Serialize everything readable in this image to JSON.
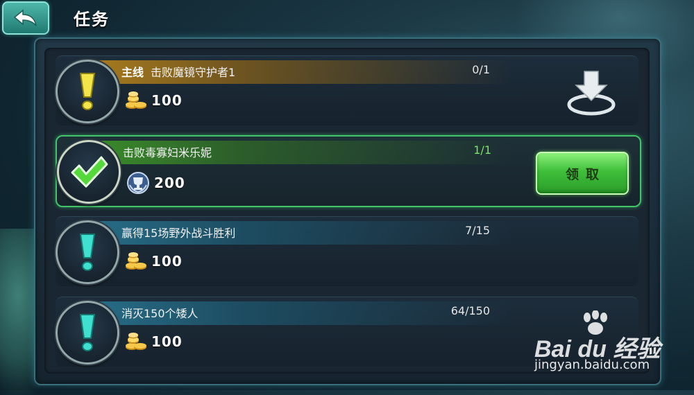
{
  "header": {
    "title": "任务",
    "back_icon": "back-arrow-icon"
  },
  "tasks": [
    {
      "tag": "主线",
      "label": "击败魔镜守护者1",
      "progress": "0/1",
      "reward_icon": "gold-coins-icon",
      "reward_amount": "100",
      "status": "goto",
      "action_icon": "goto-arrow-icon"
    },
    {
      "tag": "",
      "label": "击败毒寡妇米乐妮",
      "progress": "1/1",
      "reward_icon": "trophy-badge-icon",
      "reward_amount": "200",
      "status": "completed",
      "action_label": "领取"
    },
    {
      "tag": "",
      "label": "赢得15场野外战斗胜利",
      "progress": "7/15",
      "reward_icon": "gold-coins-icon",
      "reward_amount": "100",
      "status": "in-progress"
    },
    {
      "tag": "",
      "label": "消灭150个矮人",
      "progress": "64/150",
      "reward_icon": "gold-coins-icon",
      "reward_amount": "100",
      "status": "in-progress"
    }
  ],
  "watermark": {
    "logo": "Bai du 经验",
    "url": "jingyan.baidu.com"
  },
  "colors": {
    "accent_green": "#42c56a",
    "main_quest_gold": "#a77a1e",
    "progress_done": "#7fe36a"
  }
}
